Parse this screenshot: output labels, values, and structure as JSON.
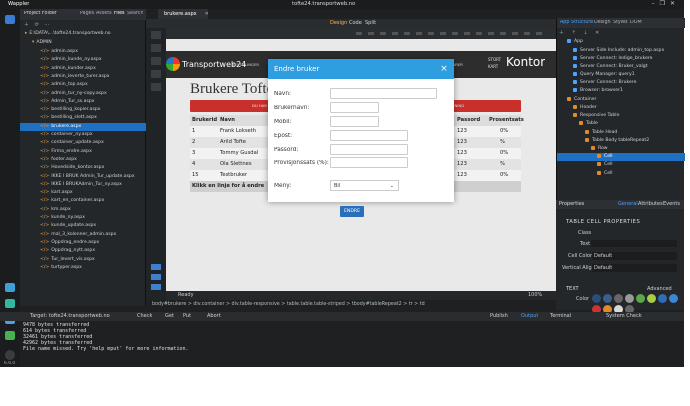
{
  "window": {
    "app": "Wappler",
    "title": "tofte24.transportweb.no"
  },
  "project_panel": {
    "title": "Project Folder",
    "tabs": [
      "Pages",
      "Assets",
      "Files",
      "Search"
    ],
    "root": "E:\\DATA\\...\\tofte24.transportweb.no",
    "admin_folder": "ADMIN",
    "files": [
      "admin.aspx",
      "admin_kunde_ny.aspx",
      "admin_kunder.aspx",
      "admin_leverte_turer.aspx",
      "admin_top.aspx",
      "admin_tur_ny-copy.aspx",
      "Admin_Tur_ss.aspx",
      "bestilling_kopier.aspx",
      "bestilling_slett.aspx",
      "brukere.aspx",
      "container_ny.aspx",
      "container_update.aspx",
      "Firma_endre.aspx",
      "footer.aspx",
      "Hovedside_kontor.aspx",
      "IKKE I BRUK Admin_Tur_update.aspx",
      "IKKE I BRUKAdmin_Tur_ny.aspx",
      "kart.aspx",
      "kart_en_container.aspx",
      "km.aspx",
      "kunde_ny.aspx",
      "kunde_update.aspx",
      "mal_3_kolonner_admin.aspx",
      "Oppdrag_endre.aspx",
      "Oppdrag_nytt.aspx",
      "Tur_levert_vis.aspx",
      "turtyper.aspx"
    ],
    "selected": "brukere.aspx"
  },
  "document": {
    "tab": "brukere.aspx",
    "modes": [
      "Design",
      "Code",
      "Split"
    ],
    "status": "Ready",
    "zoom": "100%"
  },
  "site": {
    "brand": "Transportweb24",
    "menu_left": "BESTILLINGER",
    "menu_right": "KOLONNER/VARER",
    "stort": "STORT",
    "kart": "KART",
    "kontor": "Kontor",
    "heading": "Brukere Tofte",
    "red_bar_left": "DU HAR",
    "red_bar_right": "BESLUTNING"
  },
  "table": {
    "headers": [
      "Brukerid",
      "Navn",
      "Passord",
      "Prosentsats"
    ],
    "rows": [
      [
        "1",
        "Frank Lokseth",
        "123",
        "0%"
      ],
      [
        "2",
        "Arild Tofte",
        "123",
        "%"
      ],
      [
        "3",
        "Tommy Gusdal",
        "123",
        "0%"
      ],
      [
        "4",
        "Ola Slettnes",
        "123",
        "%"
      ],
      [
        "15",
        "Testbruker",
        "123",
        "0%"
      ]
    ],
    "footer": "Klikk en linje for å endre"
  },
  "modal": {
    "title": "Endre bruker",
    "close": "×",
    "fields": [
      "Navn:",
      "Brukernavn:",
      "Mobil:",
      "Epost:",
      "Passord:",
      "Provisjonssats (%):"
    ],
    "meny_label": "Meny:",
    "meny_value": "Bil",
    "button": "ENDRE"
  },
  "breadcrumb": "body#brukere > div.container > div.table-responsive > table.table.table-striped > tbody#tableRepeat2 > tr > td",
  "app_structure": {
    "tabs": [
      "App Structure",
      "Design",
      "Styles",
      "DOM"
    ],
    "items": [
      "App",
      "Server Side Include: admin_top.aspx",
      "Server Connect: ledige_brukere",
      "Server Connect: Bruker_valgt",
      "Query Manager: query1",
      "Server Connect: Brukere",
      "Browser: browser1",
      "Container",
      "Header",
      "Responsive Table",
      "Table",
      "Table Head",
      "Table Body tableRepeat2",
      "Row",
      "Cell",
      "Cell",
      "Cell"
    ]
  },
  "properties": {
    "tabs": [
      "Properties",
      "General",
      "Attributes",
      "Events"
    ],
    "section": "TABLE CELL PROPERTIES",
    "class_label": "Class",
    "text_label": "Text",
    "cell_color_label": "Cell Color",
    "cell_color": "Default",
    "vertical_align_label": "Vertical Align",
    "vertical_align": "Default",
    "advanced": "Advanced",
    "text_section": "TEXT",
    "color_label": "Color"
  },
  "swatches": [
    "#2b4d7a",
    "#3a5f8c",
    "#666666",
    "#9a9a9a",
    "#5aa84a",
    "#aacc44",
    "#2f6db5",
    "#3d86d6",
    "#cc3333",
    "#e08a2a",
    "#d8d8d8",
    "#666666"
  ],
  "bottom": {
    "target": "Target: tofte24.transportweb.no",
    "check": "Check",
    "get": "Get",
    "put": "Put",
    "abort": "Abort",
    "publish": "Publish",
    "output": "Output",
    "terminal": "Terminal",
    "system_check": "System Check"
  },
  "console_lines": [
    "9478 bytes transferred",
    "614 bytes transferred",
    "32461 bytes transferred",
    "42962 bytes transferred",
    "File name missed. Try 'help mput' for more information."
  ],
  "version": "6.6.0"
}
